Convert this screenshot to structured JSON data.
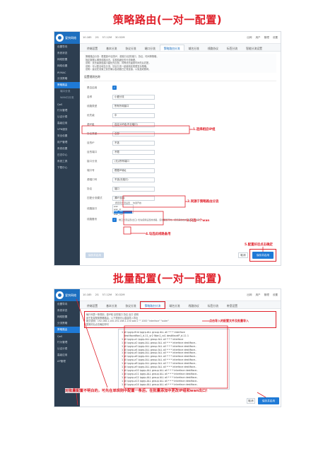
{
  "titles": {
    "strategy": "策略路由(一对一配置)",
    "batch": "批量配置(一对一配置)"
  },
  "brand": {
    "name": "爱快网络",
    "sub": "iKuai"
  },
  "top1": {
    "items": [
      "10.185",
      "2G",
      "57.12M",
      "30.52M"
    ],
    "right": [
      "出网",
      "用户",
      "管理",
      "设置"
    ]
  },
  "top2": {
    "items": [
      "10.185",
      "2G",
      "57.12M",
      "30.52M"
    ],
    "right": [
      "出网",
      "用户",
      "管理",
      "设置"
    ]
  },
  "nav1": [
    "设置导向",
    "系统状态",
    "网络配置",
    "网络设置",
    "IP/MAC",
    "分流策略",
    "策略路由",
    "端口分流",
    "WAN口分流",
    "QoS",
    "行为管理",
    "认证计费",
    "高级应用",
    "VPN服务",
    "安全设置",
    "用户管理",
    "系统设置",
    "日志中心",
    "系统工具",
    "下载中心"
  ],
  "nav2": [
    "设置导向",
    "系统状态",
    "网络配置",
    "分流策略",
    "策略路由",
    "QoS",
    "行为管理",
    "认证计费",
    "高级应用",
    "AP管理"
  ],
  "tabs": [
    "终端设置",
    "基本分流",
    "协议分流",
    "端口分流",
    "策略路由分流",
    "域名分流",
    "线路协议",
    "标签分流",
    "智能分流设置",
    "带宽设置"
  ],
  "notice1": [
    "策略路由分流：根据源IP/目的IP、源端口/目的端口、协议、时间等策略，",
    "指定数据从哪条线路出去，实现精细化的分流管理。",
    "说明：优先级数值越小越优先匹配，同等优先级按时间先后匹配。",
    "说明：可以配合域名分流、协议分流一起使用实现更复杂策略。",
    "说明：建议在设置之前先确认各线路已正常连接，以免造成断网。"
  ],
  "section1": "设置规则名称",
  "form": [
    {
      "label": "是否启用",
      "value": ""
    },
    {
      "label": "名称",
      "value": "小爱分流"
    },
    {
      "label": "线路类型",
      "value": "所有外网接口"
    },
    {
      "label": "优先级",
      "value": "中"
    },
    {
      "label": "源IP组",
      "value": "自定义IP段(不分端口)"
    },
    {
      "label": "协议类型",
      "value": "全部"
    },
    {
      "label": "目的IP",
      "value": "不选"
    },
    {
      "label": "目的端口",
      "value": "不限"
    },
    {
      "label": "接口分流",
      "value": "(无)/所有端口"
    },
    {
      "label": "端口号",
      "value": "根据IP地址"
    },
    {
      "label": "源端口号",
      "value": "不选(无端口)"
    },
    {
      "label": "协议",
      "value": "端口"
    },
    {
      "label": "匹配分流模式",
      "value": "源IP/目标"
    },
    {
      "label": "线路接口",
      "value": ""
    },
    {
      "label": "线路备份",
      "value": ""
    }
  ],
  "radio_options": [
    "按原有分流设置",
    "勾选开启"
  ],
  "wan_list": [
    "wan",
    "wan_lo",
    "wan_ro1",
    "wan_ro2"
  ],
  "backup_text": "端口分流设置(出口) 优先使用设置的线路，该线路断开时，使用其他在线线路进行分流。",
  "annotations1": [
    "1.选择相应IP组",
    "2.同源于策略路由分流",
    "3.只选一个wan",
    "4.勾选此线路备用",
    "5.配置好后点击确定"
  ],
  "buttons": {
    "cancel": "取消",
    "save": "保存并启用",
    "cancel_left": "保存并启用"
  },
  "notice2": [
    "每行代表一条规则，源IP段 目的端口 协议 出口 说明",
    "用于批量配置策略路由，以下规则可以直接导入导出",
    "格式说明：192.168.1.100-192.168.1.150 wan1 \"\" 1000 \"interface\" \"outer\"",
    "配置好后点击确定即可"
  ],
  "annotation2_top": "点击导入的配置文件及批量导入",
  "batch_lines": [
    "1 all ipgrp-first ipgrp-ALL group ALL all * * * interface",
    "   destIfaceWan1_d-11_vr2 Wan1_ro1 destIfaceIP_d-11 1",
    "1 all ipgrp-a1 ipgrp-ALL group ALL all * * * interface",
    "1 all ipgrp-a2 ipgrp-ALL group ALL all * * * interface destIface..",
    "1 all ipgrp-a3 ipgrp-ALL group ALL all * * * interface destIface..",
    "1 all ipgrp-a4 ipgrp-ALL group ALL all * * * interface destIface..",
    "1 all ipgrp-a5 ipgrp-ALL group ALL all * * * interface destIface..",
    "1 all ipgrp-a6 ipgrp-ALL group ALL all * * * interface destIface..",
    "1 all ipgrp-a7 ipgrp-ALL group ALL all * * * interface destIface..",
    "1 all ipgrp-a8 ipgrp-ALL group ALL all * * * interface destIface..",
    "1 all ipgrp-a9 ipgrp-ALL group ALL all * * * interface destIface..",
    "1 all ipgrp-a10 ipgrp-ALL group ALL all * * * interface destIface..",
    "1 all ipgrp-a11 ipgrp-ALL group ALL all * * * interface destIface..",
    "1 all ipgrp-a12 ipgrp-ALL group ALL all * * * interface destIface..",
    "1 all ipgrp-a13 ipgrp-ALL group ALL all * * * interface destIface..",
    "1 all ipgrp-a14 ipgrp-ALL group ALL all * * * interface destIface.."
  ],
  "annotation2_bottom": "对批量配置不明白的，可先在单规则中配置一条后，在批量添加中更改IP组和wan出口！",
  "colors": {
    "accent": "#1f7ad6",
    "annotation": "#e0202a",
    "sidebar": "#2d3e50"
  }
}
